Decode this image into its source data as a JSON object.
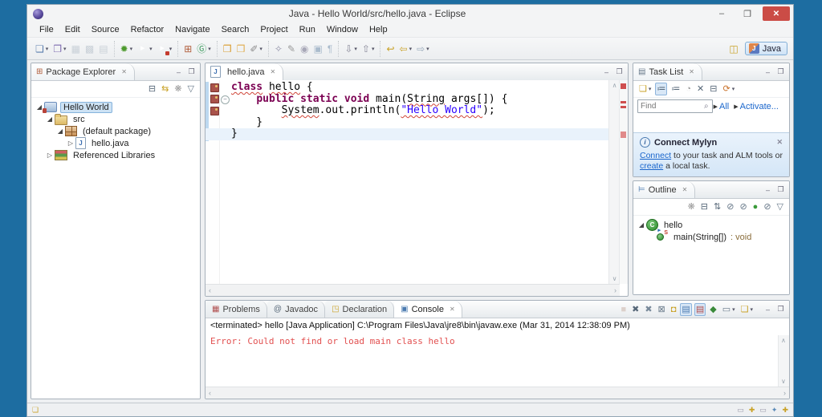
{
  "colors": {
    "desktop_background": "#1d6da1",
    "close_button": "#cb4c46",
    "selection": "#cde2f4",
    "keyword": "#7b0052",
    "string_literal": "#2a00ff",
    "error_text": "#e25050",
    "link": "#1a66cc"
  },
  "window": {
    "title": "Java - Hello World/src/hello.java - Eclipse",
    "minimize_label": "–",
    "maximize_label": "❐",
    "close_label": "✕"
  },
  "menu_bar": {
    "items": [
      "File",
      "Edit",
      "Source",
      "Refactor",
      "Navigate",
      "Search",
      "Project",
      "Run",
      "Window",
      "Help"
    ]
  },
  "toolbar": {
    "groups": [
      [
        {
          "name": "new-wizard-icon",
          "glyph": "❏",
          "color": "#5b7fae",
          "dropdown": true
        },
        {
          "name": "new-java-project-icon",
          "glyph": "❐",
          "color": "#7d6bb0",
          "dropdown": true
        },
        {
          "name": "save-icon",
          "glyph": "▦",
          "color": "#8899aa",
          "disabled": true
        },
        {
          "name": "save-all-icon",
          "glyph": "▩",
          "color": "#8899aa",
          "disabled": true
        },
        {
          "name": "print-icon",
          "glyph": "▤",
          "color": "#8899aa",
          "disabled": true
        }
      ],
      [
        {
          "name": "debug-icon",
          "glyph": "✹",
          "color": "#4e9a2e",
          "dropdown": true
        },
        {
          "name": "run-icon",
          "kind": "run",
          "dropdown": true
        },
        {
          "name": "run-history-icon",
          "kind": "run",
          "badge": true,
          "dropdown": true
        }
      ],
      [
        {
          "name": "new-java-package-icon",
          "glyph": "⊞",
          "color": "#b05c3a"
        },
        {
          "name": "new-java-class-icon",
          "glyph": "Ⓖ",
          "color": "#3a9a5c",
          "dropdown": true
        }
      ],
      [
        {
          "name": "open-type-icon",
          "glyph": "❒",
          "color": "#d99a2b"
        },
        {
          "name": "open-resource-icon",
          "glyph": "❒",
          "color": "#e0ac4e"
        },
        {
          "name": "highlighter-icon",
          "glyph": "✐",
          "color": "#8a8a8a",
          "dropdown": true
        }
      ],
      [
        {
          "name": "search-icon",
          "glyph": "✧",
          "color": "#9090a8"
        },
        {
          "name": "format-icon",
          "glyph": "✎",
          "color": "#9a9a9a"
        },
        {
          "name": "externalize-icon",
          "glyph": "◉",
          "color": "#a8a8b8"
        },
        {
          "name": "mark-occurrences-icon",
          "glyph": "▣",
          "color": "#aabbcc"
        },
        {
          "name": "show-whitespace-icon",
          "glyph": "¶",
          "color": "#aabbcc"
        }
      ],
      [
        {
          "name": "next-annotation-icon",
          "glyph": "⇩",
          "color": "#888899",
          "dropdown": true
        },
        {
          "name": "prev-annotation-icon",
          "glyph": "⇧",
          "color": "#888899",
          "dropdown": true
        }
      ],
      [
        {
          "name": "last-edit-location-icon",
          "glyph": "↩",
          "color": "#c9a227"
        },
        {
          "name": "back-icon",
          "glyph": "⇦",
          "color": "#c9a227",
          "dropdown": true
        },
        {
          "name": "forward-icon",
          "glyph": "⇨",
          "color": "#99aabb",
          "dropdown": true
        }
      ]
    ],
    "perspective": {
      "open_perspective_glyph": "◫",
      "java_label": "Java"
    }
  },
  "package_explorer": {
    "title": "Package Explorer",
    "toolbar": [
      {
        "name": "collapse-all-icon",
        "glyph": "⊟",
        "color": "#556677"
      },
      {
        "name": "link-with-editor-icon",
        "glyph": "⇆",
        "color": "#c9a227"
      },
      {
        "name": "focus-icon",
        "glyph": "❋",
        "color": "#999999"
      },
      {
        "name": "view-menu-icon",
        "glyph": "▽",
        "color": "#667788"
      }
    ],
    "tree": [
      {
        "label": "Hello World",
        "depth": 0,
        "arrow": "open",
        "selected": true,
        "icon": {
          "kind": "project"
        }
      },
      {
        "label": "src",
        "depth": 1,
        "arrow": "open",
        "icon": {
          "kind": "srcfolder"
        }
      },
      {
        "label": "(default package)",
        "depth": 2,
        "arrow": "open",
        "icon": {
          "kind": "package"
        }
      },
      {
        "label": "hello.java",
        "depth": 3,
        "arrow": "closed",
        "icon": {
          "kind": "jfile"
        }
      },
      {
        "label": "Referenced Libraries",
        "depth": 1,
        "arrow": "closed",
        "icon": {
          "kind": "library"
        }
      }
    ]
  },
  "editor": {
    "tab_label": "hello.java",
    "code": [
      {
        "segments": [
          {
            "text": "class",
            "cls": "kw sq"
          },
          {
            "text": " ",
            "cls": ""
          },
          {
            "text": "hello",
            "cls": "sq"
          },
          {
            "text": " {",
            "cls": ""
          }
        ]
      },
      {
        "segments": [
          {
            "text": "    ",
            "cls": ""
          },
          {
            "text": "public static void",
            "cls": "kw"
          },
          {
            "text": " main(",
            "cls": ""
          },
          {
            "text": "String",
            "cls": "sq"
          },
          {
            "text": " args[]) {",
            "cls": ""
          }
        ]
      },
      {
        "segments": [
          {
            "text": "        ",
            "cls": ""
          },
          {
            "text": "System",
            "cls": "sq"
          },
          {
            "text": ".out.println(",
            "cls": ""
          },
          {
            "text": "\"Hello World\"",
            "cls": "str sq"
          },
          {
            "text": ");",
            "cls": ""
          }
        ]
      },
      {
        "segments": [
          {
            "text": "    }",
            "cls": ""
          }
        ]
      },
      {
        "highlight": true,
        "segments": [
          {
            "text": "}",
            "cls": ""
          }
        ]
      }
    ]
  },
  "task_list": {
    "title": "Task List",
    "toolbar": [
      {
        "name": "new-task-icon",
        "glyph": "❏",
        "color": "#c9a227",
        "dropdown": true
      },
      {
        "name": "show-categorized-icon",
        "glyph": "≔",
        "color": "#556677",
        "active": true
      },
      {
        "name": "show-scheduled-icon",
        "glyph": "≔",
        "color": "#556677"
      },
      {
        "name": "focus-workweek-icon",
        "glyph": "◔",
        "color": "#999999"
      },
      {
        "name": "deactivate-task-icon",
        "glyph": "✕",
        "color": "#556677"
      },
      {
        "name": "collapse-all-icon",
        "glyph": "⊟",
        "color": "#556677"
      },
      {
        "name": "synchronize-icon",
        "glyph": "⟳",
        "color": "#c9722b",
        "dropdown": true
      }
    ],
    "find_placeholder": "Find",
    "filters": [
      "All",
      "Activate..."
    ],
    "mylyn": {
      "title": "Connect Mylyn",
      "segments": [
        {
          "text": "Connect",
          "link": true
        },
        {
          "text": " to your task and ALM tools or ",
          "link": false
        },
        {
          "text": "create",
          "link": true
        },
        {
          "text": " a local task.",
          "link": false
        }
      ]
    }
  },
  "outline": {
    "title": "Outline",
    "toolbar": [
      {
        "name": "focus-icon",
        "glyph": "❋",
        "color": "#999999"
      },
      {
        "name": "collapse-all-icon",
        "glyph": "⊟",
        "color": "#556677"
      },
      {
        "name": "sort-icon",
        "glyph": "⇅",
        "color": "#556677"
      },
      {
        "name": "hide-fields-icon",
        "glyph": "⊘",
        "color": "#667788"
      },
      {
        "name": "hide-static-icon",
        "glyph": "⊘",
        "color": "#667788"
      },
      {
        "name": "hide-non-public-icon",
        "glyph": "●",
        "color": "#3a9a3a"
      },
      {
        "name": "hide-local-types-icon",
        "glyph": "⊘",
        "color": "#667788"
      },
      {
        "name": "view-menu-icon",
        "glyph": "▽",
        "color": "#667788"
      }
    ],
    "tree": [
      {
        "label": "hello",
        "depth": 0,
        "arrow": "open",
        "icon": {
          "kind": "class"
        }
      },
      {
        "label": "main(String[])",
        "suffix": " : void",
        "depth": 1,
        "icon": {
          "kind": "static-method"
        }
      }
    ]
  },
  "console": {
    "tabs": [
      {
        "label": "Problems",
        "icon_name": "problems-icon",
        "glyph": "▦",
        "color": "#b05050"
      },
      {
        "label": "Javadoc",
        "icon_name": "javadoc-icon",
        "glyph": "@",
        "color": "#556677"
      },
      {
        "label": "Declaration",
        "icon_name": "declaration-icon",
        "glyph": "◳",
        "color": "#c9a227"
      },
      {
        "label": "Console",
        "icon_name": "console-icon",
        "glyph": "▣",
        "color": "#4a7ab0",
        "active": true
      }
    ],
    "toolbar": [
      {
        "name": "terminate-icon",
        "glyph": "■",
        "color": "#bb9988",
        "disabled": true
      },
      {
        "name": "remove-launch-icon",
        "glyph": "✖",
        "color": "#556677"
      },
      {
        "name": "remove-all-launches-icon",
        "glyph": "✖",
        "color": "#778899"
      },
      {
        "name": "clear-console-icon",
        "glyph": "⊠",
        "color": "#667788"
      },
      {
        "name": "scroll-lock-icon",
        "glyph": "◘",
        "color": "#c9a227"
      },
      {
        "name": "show-stdout-icon",
        "glyph": "▤",
        "color": "#4a7ab0",
        "active": true
      },
      {
        "name": "show-stderr-icon",
        "glyph": "▤",
        "color": "#b04a4a",
        "active": true
      },
      {
        "name": "pin-console-icon",
        "glyph": "◆",
        "color": "#3a8a3a"
      },
      {
        "name": "display-console-icon",
        "glyph": "▭",
        "color": "#667788",
        "dropdown": true
      },
      {
        "name": "open-console-icon",
        "glyph": "❏",
        "color": "#c9a227",
        "dropdown": true
      }
    ],
    "header_line": "<terminated> hello [Java Application] C:\\Program Files\\Java\\jre8\\bin\\javaw.exe (Mar 31, 2014 12:38:09 PM)",
    "error_line": "Error: Could not find or load main class hello"
  }
}
